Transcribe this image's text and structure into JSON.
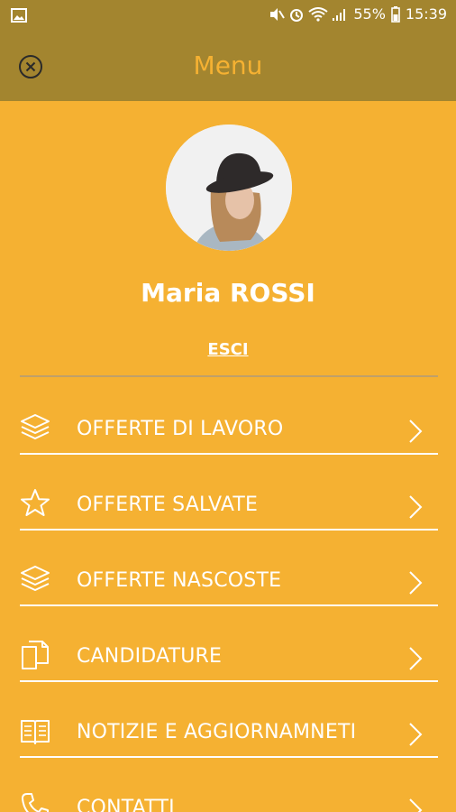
{
  "status_bar": {
    "battery": "55%",
    "time": "15:39"
  },
  "app_bar": {
    "title": "Menu"
  },
  "profile": {
    "name": "Maria ROSSI",
    "logout_label": "ESCI"
  },
  "menu": {
    "items": [
      {
        "label": "OFFERTE DI LAVORO",
        "icon": "layers-icon"
      },
      {
        "label": "OFFERTE SALVATE",
        "icon": "star-icon"
      },
      {
        "label": "OFFERTE NASCOSTE",
        "icon": "layers-icon"
      },
      {
        "label": "CANDIDATURE",
        "icon": "documents-icon"
      },
      {
        "label": "NOTIZIE E AGGIORNAMNETI",
        "icon": "book-icon"
      },
      {
        "label": "CONTATTI",
        "icon": "phone-icon"
      }
    ]
  },
  "colors": {
    "background": "#F5B132",
    "header": "#A3852F",
    "title": "#F5B132",
    "text": "#FFFFFF"
  }
}
